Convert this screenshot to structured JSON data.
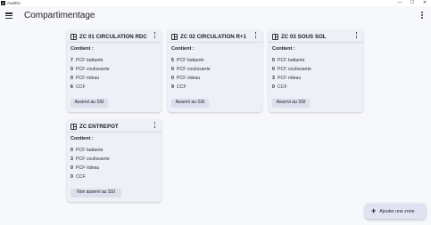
{
  "window": {
    "app_icon": "A",
    "title": "AvalOA",
    "controls": [
      "—",
      "☐",
      "✕"
    ]
  },
  "appbar": {
    "title": "Compartimentage",
    "menu_icon": "hamburger-icon",
    "more_icon": "more-vert-icon"
  },
  "content_label": "Contient :",
  "cards": [
    {
      "title": "ZC 01 CIRCULATION RDC",
      "items": [
        {
          "count": "7",
          "label": "PCF battante"
        },
        {
          "count": "0",
          "label": "PCF coulissante"
        },
        {
          "count": "0",
          "label": "PCF rideau"
        },
        {
          "count": "6",
          "label": "CCF"
        }
      ],
      "button": "Asservi au SSI"
    },
    {
      "title": "ZC 02 CIRCULATION R+1",
      "items": [
        {
          "count": "5",
          "label": "PCF battante"
        },
        {
          "count": "0",
          "label": "PCF coulissante"
        },
        {
          "count": "0",
          "label": "PCF rideau"
        },
        {
          "count": "9",
          "label": "CCF"
        }
      ],
      "button": "Asservi au SSI"
    },
    {
      "title": "ZC 03 SOUS SOL",
      "items": [
        {
          "count": "0",
          "label": "PCF battante"
        },
        {
          "count": "0",
          "label": "PCF coulissante"
        },
        {
          "count": "3",
          "label": "PCF rideau"
        },
        {
          "count": "0",
          "label": "CCF"
        }
      ],
      "button": "Asservi au SSI"
    },
    {
      "title": "ZC  ENTREPOT",
      "items": [
        {
          "count": "0",
          "label": "PCF battante"
        },
        {
          "count": "3",
          "label": "PCF coulissante"
        },
        {
          "count": "0",
          "label": "PCF rideau"
        },
        {
          "count": "0",
          "label": "CCF"
        }
      ],
      "button": "Non asservi au SSI"
    }
  ],
  "fab": {
    "icon": "plus-icon",
    "symbol": "+",
    "label": "Ajouter une zone"
  }
}
